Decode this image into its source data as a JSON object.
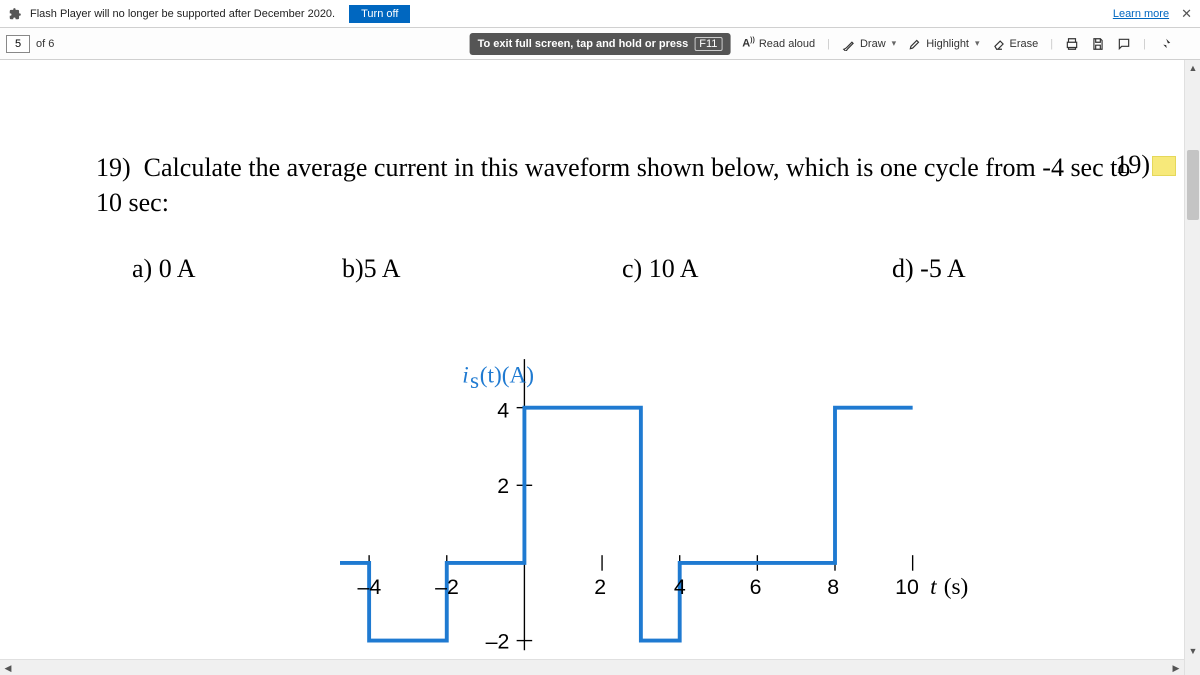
{
  "flash": {
    "message": "Flash Player will no longer be supported after December 2020.",
    "turn_off": "Turn off",
    "learn_more": "Learn more"
  },
  "pdf": {
    "page_value": "5",
    "of_label": "of 6",
    "fullscreen_hint": "To exit full screen, tap and hold or press",
    "fullscreen_key": "F11",
    "read_aloud": "Read aloud",
    "draw": "Draw",
    "highlight": "Highlight",
    "erase": "Erase"
  },
  "question": {
    "number_left": "19)",
    "text": "Calculate the average current in this waveform shown below, which is one cycle from -4 sec to 10 sec:",
    "number_right": "19)",
    "choices": {
      "a": "a)  0 A",
      "b": "b)5 A",
      "c": "c) 10 A",
      "d": "d) -5 A"
    }
  },
  "plot": {
    "ylabel": "i",
    "ylabel_sub": "s",
    "ylabel_rest": "(t)(A)",
    "xlabel": "t (s)",
    "yticks": {
      "4": "4",
      "2": "2",
      "m2": "–2"
    },
    "xticks": {
      "m4": "–4",
      "m2": "–2",
      "2": "2",
      "4": "4",
      "6": "6",
      "8": "8",
      "10": "10"
    }
  },
  "chart_data": {
    "type": "line",
    "title": "",
    "xlabel": "t (s)",
    "ylabel": "i_s(t) (A)",
    "xlim": [
      -5,
      11
    ],
    "ylim": [
      -3,
      5
    ],
    "series": [
      {
        "name": "i_s(t)",
        "x": [
          -4,
          -4,
          -2,
          -2,
          0,
          0,
          3,
          3,
          4,
          4,
          8,
          8,
          10
        ],
        "y": [
          0,
          -2,
          -2,
          0,
          0,
          4,
          4,
          -2,
          -2,
          0,
          0,
          4,
          4
        ]
      }
    ],
    "xticks": [
      -4,
      -2,
      2,
      4,
      6,
      8,
      10
    ],
    "yticks": [
      -2,
      2,
      4
    ]
  }
}
